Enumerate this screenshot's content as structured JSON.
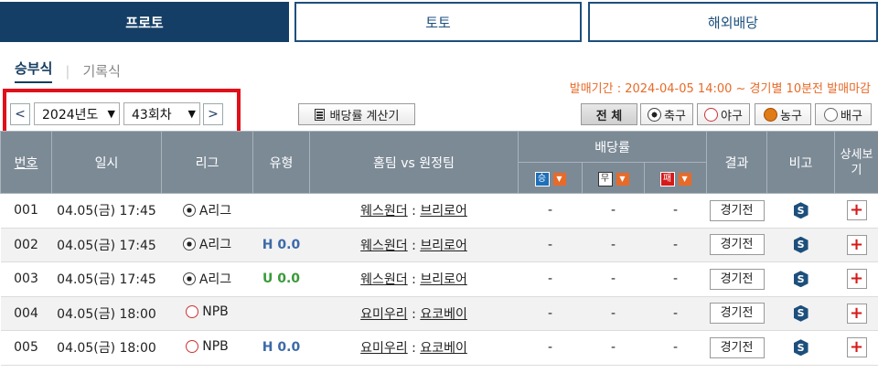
{
  "top_tabs": [
    "프로토",
    "토토",
    "해외배당"
  ],
  "subtabs": {
    "active": "승부식",
    "other": "기록식"
  },
  "notice": "발매기간 : 2024-04-05 14:00 ~ 경기별 10분전 발매마감",
  "controls": {
    "prev": "<",
    "next": ">",
    "year": "2024년도",
    "round": "43회차",
    "calc_label": "배당률 계산기"
  },
  "filters": {
    "all": "전 체",
    "soccer": "축구",
    "baseball": "야구",
    "basketball": "농구",
    "volleyball": "배구"
  },
  "table": {
    "headers": {
      "no": "번호",
      "time": "일시",
      "league": "리그",
      "type": "유형",
      "match": "홈팀 vs 원정팀",
      "odds": "배당률",
      "win": "승",
      "draw": "무",
      "lose": "패",
      "result": "결과",
      "note": "비고",
      "detail": "상세보기"
    },
    "rows": [
      {
        "no": "001",
        "time": "04.05(금) 17:45",
        "league": "A리그",
        "sport": "soccer",
        "type": "",
        "home": "웨스원더",
        "away": "브리로어",
        "win": "-",
        "draw": "-",
        "lose": "-",
        "result": "경기전"
      },
      {
        "no": "002",
        "time": "04.05(금) 17:45",
        "league": "A리그",
        "sport": "soccer",
        "type": "H 0.0",
        "home": "웨스원더",
        "away": "브리로어",
        "win": "-",
        "draw": "-",
        "lose": "-",
        "result": "경기전"
      },
      {
        "no": "003",
        "time": "04.05(금) 17:45",
        "league": "A리그",
        "sport": "soccer",
        "type": "U 0.0",
        "home": "웨스원더",
        "away": "브리로어",
        "win": "-",
        "draw": "-",
        "lose": "-",
        "result": "경기전"
      },
      {
        "no": "004",
        "time": "04.05(금) 18:00",
        "league": "NPB",
        "sport": "baseball",
        "type": "",
        "home": "요미우리",
        "away": "요코베이",
        "win": "-",
        "draw": "-",
        "lose": "-",
        "result": "경기전"
      },
      {
        "no": "005",
        "time": "04.05(금) 18:00",
        "league": "NPB",
        "sport": "baseball",
        "type": "H 0.0",
        "home": "요미우리",
        "away": "요코베이",
        "win": "-",
        "draw": "-",
        "lose": "-",
        "result": "경기전"
      }
    ]
  },
  "colors": {
    "navy": "#143e66",
    "header_gray": "#7c8a96",
    "notice_orange": "#e86a28",
    "highlight_red": "#e0101a"
  }
}
